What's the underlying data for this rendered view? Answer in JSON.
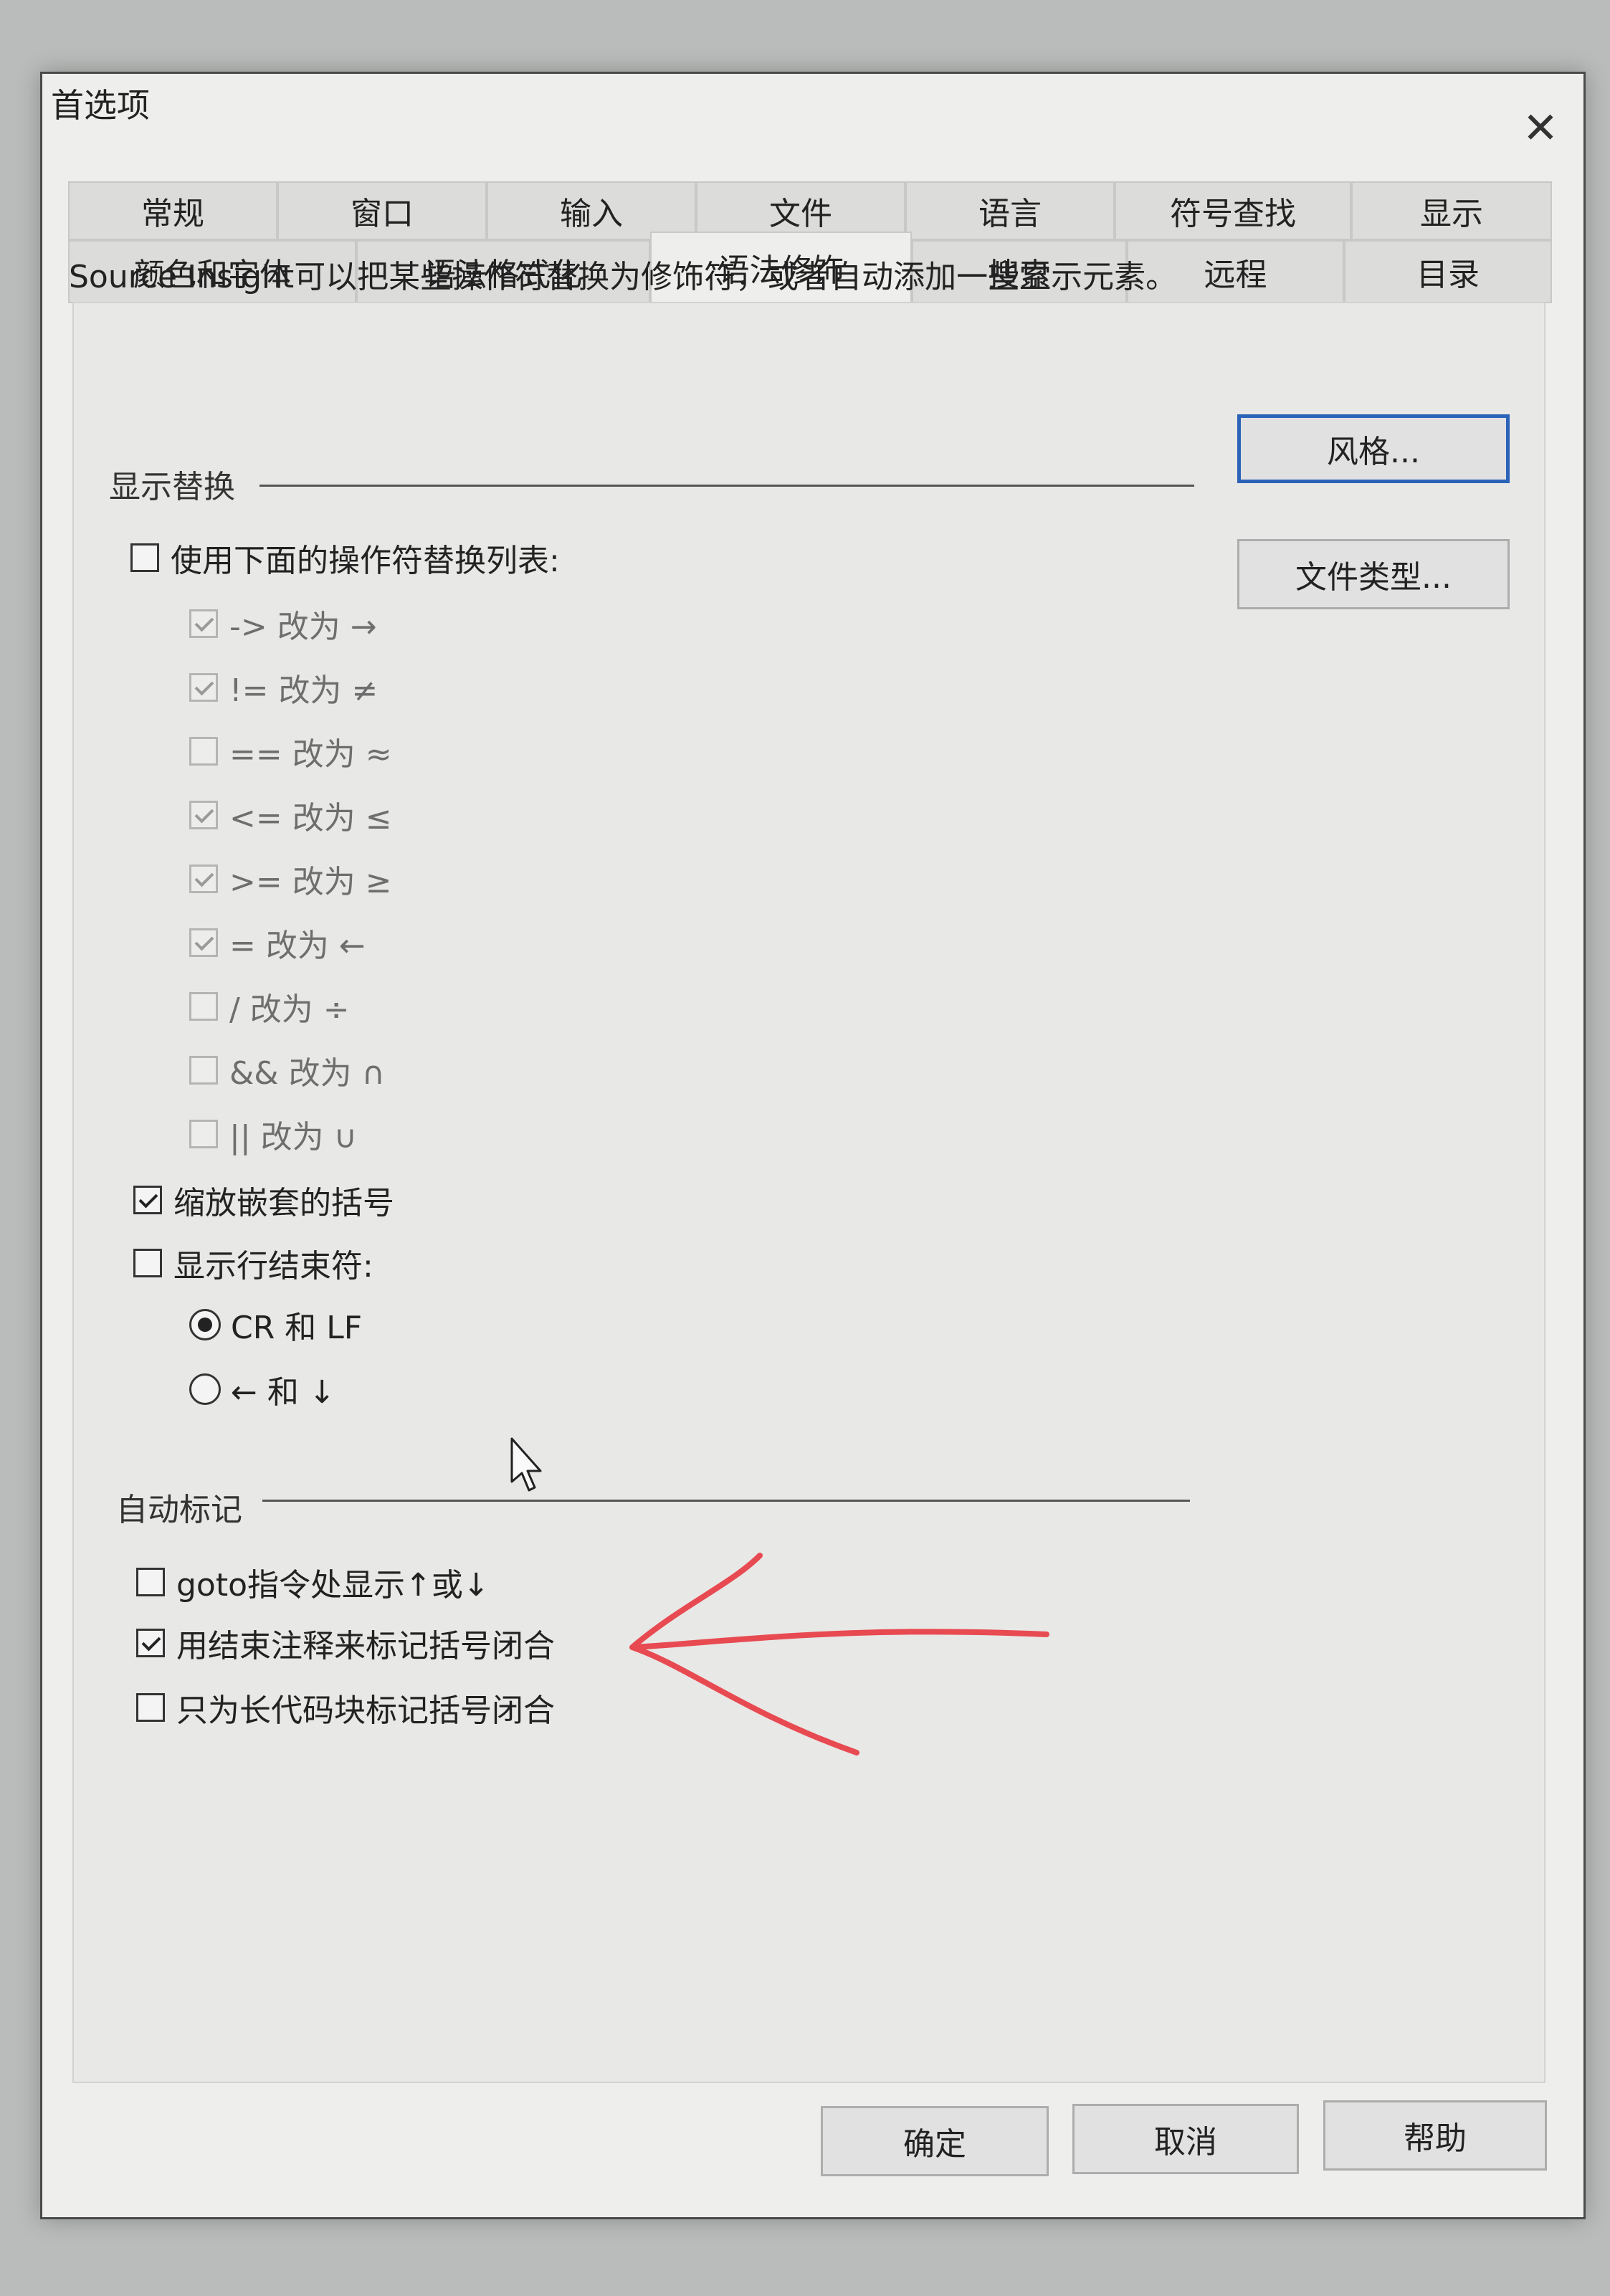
{
  "window": {
    "title": "首选项",
    "close_symbol": "✕"
  },
  "tabs_row1": [
    {
      "label": "常规"
    },
    {
      "label": "窗口"
    },
    {
      "label": "输入"
    },
    {
      "label": "文件"
    },
    {
      "label": "语言"
    },
    {
      "label": "符号查找"
    },
    {
      "label": "显示"
    }
  ],
  "tabs_row2": [
    {
      "label": "颜色和字体"
    },
    {
      "label": "语法格式化"
    },
    {
      "label": "语法修饰",
      "active": true
    },
    {
      "label": "搜索"
    },
    {
      "label": "远程"
    },
    {
      "label": "目录"
    }
  ],
  "description": "Source Insight可以把某些操作符替换为修饰符，或者自动添加一些显示元素。",
  "buttons": {
    "style": "风格...",
    "file_types": "文件类型..."
  },
  "display_replacement": {
    "label": "显示替换",
    "use_list": {
      "label": "使用下面的操作符替换列表:",
      "checked": false
    },
    "items": [
      {
        "label": "-> 改为 →",
        "checked": true
      },
      {
        "label": "!= 改为 ≠",
        "checked": true
      },
      {
        "label": "== 改为 ≈",
        "checked": false
      },
      {
        "label": "<= 改为 ≤",
        "checked": true
      },
      {
        "label": ">= 改为 ≥",
        "checked": true
      },
      {
        "label": "= 改为 ←",
        "checked": true
      },
      {
        "label": "/ 改为 ÷",
        "checked": false
      },
      {
        "label": "&& 改为 ∩",
        "checked": false
      },
      {
        "label": "|| 改为 ∪",
        "checked": false
      }
    ],
    "scale_brackets": {
      "label": "缩放嵌套的括号",
      "checked": true
    },
    "show_line_end": {
      "label": "显示行结束符:",
      "checked": false
    },
    "line_end_options": [
      {
        "label": "CR 和 LF",
        "checked": true
      },
      {
        "label": "← 和 ↓",
        "checked": false
      }
    ]
  },
  "auto_annotation": {
    "label": "自动标记",
    "items": [
      {
        "label": "goto指令处显示↑或↓",
        "checked": false
      },
      {
        "label": "用结束注释来标记括号闭合",
        "checked": true
      },
      {
        "label": "只为长代码块标记括号闭合",
        "checked": false
      }
    ]
  },
  "footer": {
    "ok": "确定",
    "cancel": "取消",
    "help": "帮助"
  },
  "colors": {
    "focus_border": "#2b63b8",
    "annotation_arrow": "#e84a52"
  }
}
